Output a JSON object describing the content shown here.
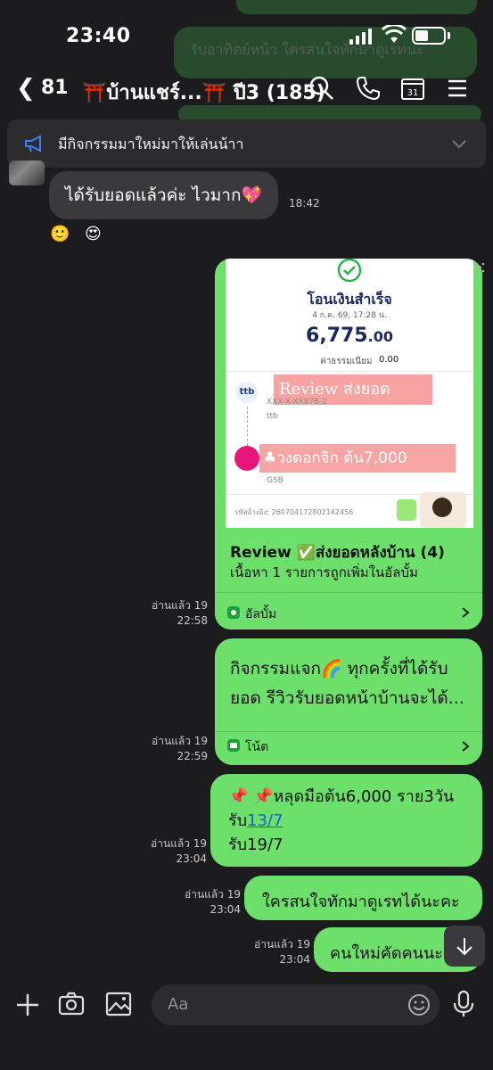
{
  "status_bar": {
    "time": "23:40"
  },
  "header": {
    "back_count": "81",
    "title": "⛩️บ้านแชร์...⛩️ ปี3 (185)"
  },
  "announcement": {
    "text": "มีกิจกรรมมาใหม่มาให้เล่นน้าา"
  },
  "background_text": {
    "line1": "รับอาทิตย์หน้า ใครสนใจทักมาดูเรทนะ"
  },
  "received_message": {
    "text": "ได้รับยอดแล้วค่ะ ไวมาก💖",
    "time": "18:42",
    "reactions": [
      "🙂",
      "😍"
    ]
  },
  "album_message": {
    "receipt": {
      "title": "โอนเงินสำเร็จ",
      "date": "4 ก.ค. 69, 17:28 น.",
      "amount": "6,775",
      "amount_decimal": ".00",
      "fee_label": "ค่าธรรมเนียม",
      "fee_value": "0.00",
      "from_bank": "ttb",
      "from_account": "XXX-X-XX878-2",
      "to_bank": "GSB",
      "ref": "รหัสอ้างอิง: 260704172802142456",
      "stamp_review": "Review ส่งยอด",
      "stamp_amount": "♣วงดอกจิก ต้น7,000"
    },
    "title": "Review ✅ส่งยอดหลังบ้าน (4)",
    "subtitle": "เนื้อหา 1 รายการถูกเพิ่มในอัลบั้ม",
    "link_label": "อัลบั้ม",
    "read": "อ่านแล้ว 19",
    "time": "22:58"
  },
  "note_message": {
    "text": "กิจกรรมแจก🌈 ทุกครั้งที่ได้รับยอด รีวิวรับยอดหน้าบ้านจะได้...",
    "link_label": "โน้ต",
    "read": "อ่านแล้ว 19",
    "time": "22:59"
  },
  "pin_message": {
    "line1": "📌 📌หลุดมือต้น6,000 ราย3วัน",
    "line2_prefix": "รับ",
    "line2_link": "13/7",
    "line3": "รับ19/7",
    "read": "อ่านแล้ว 19",
    "time": "23:04"
  },
  "msg_interested": {
    "text": "ใครสนใจทักมาดูเรทได้นะคะ",
    "read": "อ่านแล้ว 19",
    "time": "23:04"
  },
  "msg_newcomer": {
    "text": "คนใหม่คัดคนนะ",
    "read": "อ่านแล้ว 19",
    "time": "23:04"
  },
  "input": {
    "placeholder": "Aa"
  },
  "colors": {
    "bubble_green": "#6ce06a",
    "background": "#1c1c1e",
    "received_bubble": "#3a3a3c"
  }
}
